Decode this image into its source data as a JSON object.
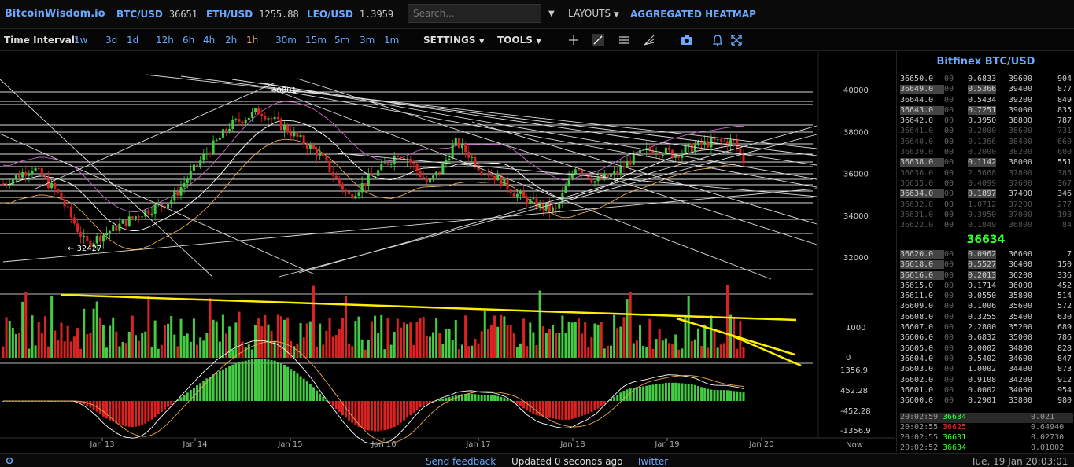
{
  "header": {
    "brand": "BitcoinWisdom.io",
    "tickers": [
      {
        "symbol": "BTC/USD",
        "price": "36651"
      },
      {
        "symbol": "ETH/USD",
        "price": "1255.88"
      },
      {
        "symbol": "LEO/USD",
        "price": "1.3959"
      }
    ],
    "search_placeholder": "Search...",
    "layouts_label": "LAYOUTS",
    "heatmap_label": "AGGREGATED HEATMAP"
  },
  "toolbar": {
    "time_interval_label": "Time Interval:",
    "intervals": [
      "1w",
      "3d",
      "1d",
      "12h",
      "6h",
      "4h",
      "2h",
      "1h",
      "30m",
      "15m",
      "5m",
      "3m",
      "1m"
    ],
    "active_interval": "1h",
    "settings_label": "SETTINGS",
    "tools_label": "TOOLS"
  },
  "chart": {
    "price_axis": [
      "40000",
      "38000",
      "36000",
      "34000",
      "32000"
    ],
    "volume_axis": [
      "1000",
      "0"
    ],
    "macd_axis": [
      "1356.9",
      "452.28",
      "-452.28",
      "-1356.9"
    ],
    "date_labels": [
      "Jan 13",
      "Jan 14",
      "Jan 15",
      "Jan 16",
      "Jan 17",
      "Jan 18",
      "Jan 19",
      "Jan 20"
    ],
    "now_label": "Now",
    "high_marker": "40801",
    "low_marker": "← 32427",
    "colors": {
      "up": "#44cc44",
      "down": "#dd2222",
      "trend": "#ffee00",
      "line": "#cccccc",
      "boll": "#cc66cc",
      "ma": "#e8a94a"
    }
  },
  "chart_data": {
    "type": "candlestick",
    "x": [
      "Jan 13",
      "Jan 14",
      "Jan 15",
      "Jan 16",
      "Jan 17",
      "Jan 18",
      "Jan 19",
      "Jan 20"
    ],
    "price_range": [
      31000,
      41000
    ],
    "close_approx": [
      34000,
      37500,
      39500,
      36500,
      34300,
      35800,
      37100,
      36651
    ],
    "volume_range": [
      0,
      1400
    ],
    "macd_range": [
      -1356.9,
      1356.9
    ]
  },
  "orderbook": {
    "title": "Bitfinex BTC/USD",
    "asks": [
      {
        "price": "36650.0",
        "frac": "00",
        "amt": "0.6833",
        "total": "39600",
        "count": "904",
        "hl": false,
        "col": "#ccc"
      },
      {
        "price": "36649.0",
        "frac": "00",
        "amt": "0.5366",
        "total": "39400",
        "count": "877",
        "hl": true,
        "col": "#ccc"
      },
      {
        "price": "36644.0",
        "frac": "00",
        "amt": "0.5434",
        "total": "39200",
        "count": "849",
        "hl": false,
        "col": "#ccc"
      },
      {
        "price": "36643.0",
        "frac": "00",
        "amt": "0.7251",
        "total": "39000",
        "count": "835",
        "hl": true,
        "col": "#ccc"
      },
      {
        "price": "36642.0",
        "frac": "00",
        "amt": "0.3950",
        "total": "38800",
        "count": "787",
        "hl": false,
        "col": "#ccc"
      },
      {
        "price": "36641.0",
        "frac": "00",
        "amt": "0.2000",
        "total": "38600",
        "count": "731",
        "hl": false,
        "col": "#555"
      },
      {
        "price": "36640.0",
        "frac": "00",
        "amt": "0.1366",
        "total": "38400",
        "count": "660",
        "hl": false,
        "col": "#555"
      },
      {
        "price": "36639.0",
        "frac": "00",
        "amt": "0.2000",
        "total": "38200",
        "count": "600",
        "hl": false,
        "col": "#555"
      },
      {
        "price": "36638.0",
        "frac": "00",
        "amt": "0.1142",
        "total": "38000",
        "count": "551",
        "hl": true,
        "col": "#ccc"
      },
      {
        "price": "36636.0",
        "frac": "00",
        "amt": "2.5668",
        "total": "37800",
        "count": "385",
        "hl": false,
        "col": "#555"
      },
      {
        "price": "36635.0",
        "frac": "00",
        "amt": "0.4099",
        "total": "37600",
        "count": "367",
        "hl": false,
        "col": "#555"
      },
      {
        "price": "36634.0",
        "frac": "00",
        "amt": "0.1897",
        "total": "37400",
        "count": "346",
        "hl": true,
        "col": "#ccc"
      },
      {
        "price": "36632.0",
        "frac": "00",
        "amt": "1.0712",
        "total": "37200",
        "count": "277",
        "hl": false,
        "col": "#555"
      },
      {
        "price": "36631.0",
        "frac": "00",
        "amt": "0.3950",
        "total": "37000",
        "count": "198",
        "hl": false,
        "col": "#555"
      },
      {
        "price": "36622.0",
        "frac": "00",
        "amt": "0.1849",
        "total": "36800",
        "count": "84",
        "hl": false,
        "col": "#555"
      }
    ],
    "mid": "36634",
    "bids": [
      {
        "price": "36620.0",
        "frac": "00",
        "amt": "0.0962",
        "total": "36600",
        "count": "7",
        "hl": true,
        "col": "#ccc"
      },
      {
        "price": "36618.0",
        "frac": "00",
        "amt": "0.5527",
        "total": "36400",
        "count": "150",
        "hl": true,
        "col": "#ccc"
      },
      {
        "price": "36616.0",
        "frac": "00",
        "amt": "0.2013",
        "total": "36200",
        "count": "336",
        "hl": true,
        "col": "#ccc"
      },
      {
        "price": "36615.0",
        "frac": "00",
        "amt": "0.1714",
        "total": "36000",
        "count": "452",
        "hl": false,
        "col": "#ccc"
      },
      {
        "price": "36611.0",
        "frac": "00",
        "amt": "0.0550",
        "total": "35800",
        "count": "514",
        "hl": false,
        "col": "#ccc"
      },
      {
        "price": "36609.0",
        "frac": "00",
        "amt": "0.1006",
        "total": "35600",
        "count": "572",
        "hl": false,
        "col": "#ccc"
      },
      {
        "price": "36608.0",
        "frac": "00",
        "amt": "0.3255",
        "total": "35400",
        "count": "630",
        "hl": false,
        "col": "#ccc"
      },
      {
        "price": "36607.0",
        "frac": "00",
        "amt": "2.2800",
        "total": "35200",
        "count": "689",
        "hl": false,
        "col": "#ccc"
      },
      {
        "price": "36606.0",
        "frac": "00",
        "amt": "0.6832",
        "total": "35000",
        "count": "786",
        "hl": false,
        "col": "#ccc"
      },
      {
        "price": "36605.0",
        "frac": "00",
        "amt": "0.0002",
        "total": "34800",
        "count": "828",
        "hl": false,
        "col": "#ccc"
      },
      {
        "price": "36604.0",
        "frac": "00",
        "amt": "0.5402",
        "total": "34600",
        "count": "847",
        "hl": false,
        "col": "#ccc"
      },
      {
        "price": "36603.0",
        "frac": "00",
        "amt": "1.0002",
        "total": "34400",
        "count": "873",
        "hl": false,
        "col": "#ccc"
      },
      {
        "price": "36602.0",
        "frac": "00",
        "amt": "0.9108",
        "total": "34200",
        "count": "912",
        "hl": false,
        "col": "#ccc"
      },
      {
        "price": "36601.0",
        "frac": "00",
        "amt": "0.0002",
        "total": "34000",
        "count": "954",
        "hl": false,
        "col": "#ccc"
      },
      {
        "price": "36600.0",
        "frac": "00",
        "amt": "0.2901",
        "total": "33800",
        "count": "980",
        "hl": false,
        "col": "#ccc"
      }
    ],
    "trades": [
      {
        "time": "20:02:59",
        "price": "36634",
        "amt": "0.021",
        "pcol": "#3f3"
      },
      {
        "time": "20:02:55",
        "price": "36625",
        "amt": "0.64940",
        "pcol": "#e33"
      },
      {
        "time": "20:02:55",
        "price": "36631",
        "amt": "0.02730",
        "pcol": "#3f3"
      },
      {
        "time": "20:02:52",
        "price": "36634",
        "amt": "0.01002",
        "pcol": "#3f3"
      }
    ]
  },
  "footer": {
    "feedback": "Send feedback",
    "updated": "Updated 0 seconds ago",
    "twitter": "Twitter",
    "datetime": "Tue, 19 Jan 20:03:01"
  }
}
